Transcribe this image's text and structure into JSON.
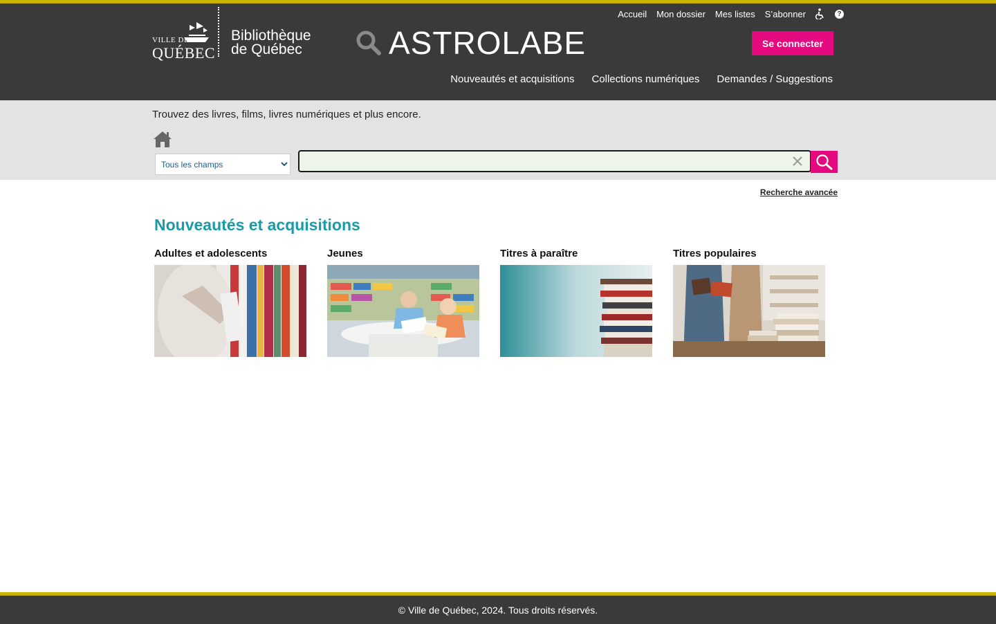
{
  "header": {
    "util_links": [
      "Accueil",
      "Mon dossier",
      "Mes listes",
      "S’abonner"
    ],
    "ville_small": "VILLE DE",
    "ville_big": "QUÉBEC",
    "biblio_line1": "Bibliothèque",
    "biblio_line2": "de Québec",
    "catalog_name": "ASTROLABE",
    "login_label": "Se connecter",
    "nav": [
      "Nouveautés et acquisitions",
      "Collections numériques",
      "Demandes / Suggestions"
    ],
    "colors": {
      "bar": "#3a3a3a",
      "stripe": "#c8b400",
      "accent": "#e5097f"
    }
  },
  "search": {
    "tagline": "Trouvez des livres, films, livres numériques et plus encore.",
    "field_selected": "Tous les champs",
    "query": "",
    "advanced_label": "Recherche avancée"
  },
  "main": {
    "section_title": "Nouveautés et acquisitions",
    "cards": [
      {
        "title": "Adultes et adolescents"
      },
      {
        "title": "Jeunes"
      },
      {
        "title": "Titres à paraître"
      },
      {
        "title": "Titres populaires"
      }
    ]
  },
  "footer": {
    "text": "© Ville de Québec, 2024. Tous droits réservés."
  }
}
